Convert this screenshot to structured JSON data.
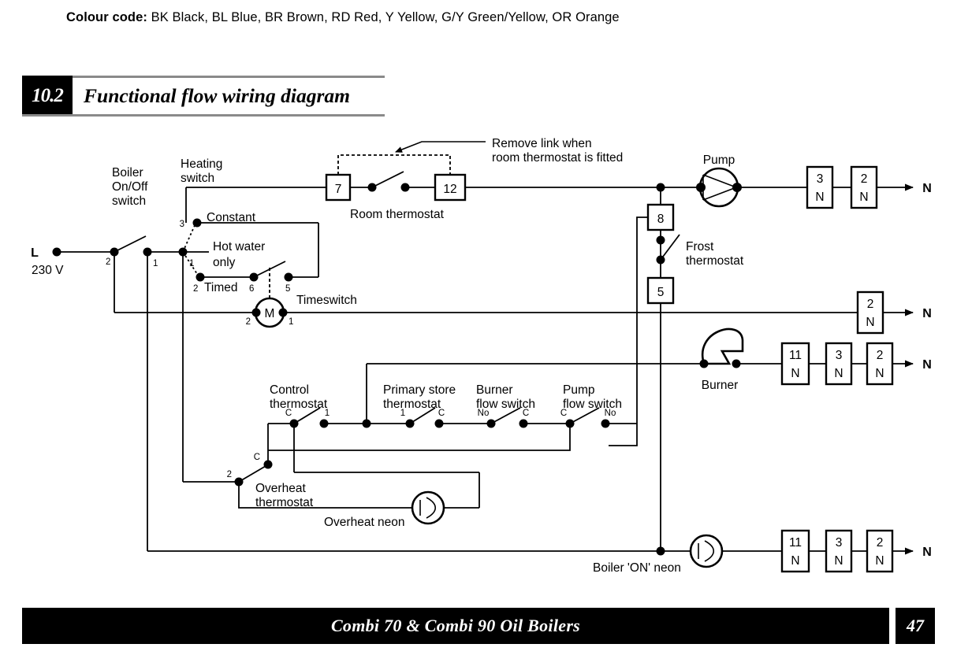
{
  "colour_code": {
    "label": "Colour code:",
    "text": " BK Black, BL Blue, BR Brown, RD Red, Y Yellow, G/Y Green/Yellow, OR Orange"
  },
  "section": {
    "number": "10.2",
    "title": "Functional flow wiring diagram"
  },
  "footer": {
    "title": "Combi 70 & Combi 90 Oil Boilers",
    "page": "47"
  },
  "diagram": {
    "supply": {
      "phase": "L",
      "voltage": "230 V"
    },
    "labels": {
      "boiler_onoff": [
        "Boiler",
        "On/Off",
        "switch"
      ],
      "heating_switch": [
        "Heating",
        "switch"
      ],
      "constant": "Constant",
      "hot_water_only": [
        "Hot water",
        "only"
      ],
      "timed": "Timed",
      "timeswitch": "Timeswitch",
      "room_thermostat": "Room thermostat",
      "remove_link": [
        "Remove link when",
        "room thermostat is fitted"
      ],
      "pump": "Pump",
      "frost_thermostat": [
        "Frost",
        "thermostat"
      ],
      "burner": "Burner",
      "control_thermostat": [
        "Control",
        "thermostat"
      ],
      "primary_store_thermostat": [
        "Primary store",
        "thermostat"
      ],
      "burner_flow_switch": [
        "Burner",
        "flow switch"
      ],
      "pump_flow_switch": [
        "Pump",
        "flow switch"
      ],
      "overheat_thermostat": [
        "Overheat",
        "thermostat"
      ],
      "overheat_neon": "Overheat neon",
      "boiler_on_neon": "Boiler 'ON' neon",
      "motor_symbol": "M"
    },
    "terminal_markers": {
      "boiler_onoff_left": "2",
      "boiler_onoff_right": "1",
      "selector_common": "1",
      "selector_constant": "3",
      "selector_timed": "2",
      "timeswitch_6": "6",
      "timeswitch_5": "5",
      "timeswitch_2": "2",
      "timeswitch_1": "1",
      "control_thermostat_c": "C",
      "control_thermostat_1": "1",
      "primary_store_1": "1",
      "primary_store_c": "C",
      "burner_flow_no": "No",
      "burner_flow_c": "C",
      "pump_flow_c": "C",
      "pump_flow_no": "No",
      "overheat_c": "C",
      "overheat_2": "2"
    },
    "terminal_blocks": [
      {
        "id": "t7",
        "top": "7",
        "bottom": ""
      },
      {
        "id": "t12",
        "top": "12",
        "bottom": ""
      },
      {
        "id": "t8",
        "top": "8",
        "bottom": ""
      },
      {
        "id": "t5",
        "top": "5",
        "bottom": ""
      }
    ],
    "neutral_rows": [
      {
        "id": "pump-row",
        "blocks": [
          {
            "top": "3",
            "bottom": "N"
          },
          {
            "top": "2",
            "bottom": "N"
          }
        ],
        "arrow_label": "N"
      },
      {
        "id": "timeswitch-row",
        "blocks": [
          {
            "top": "2",
            "bottom": "N"
          }
        ],
        "arrow_label": "N"
      },
      {
        "id": "burner-row",
        "blocks": [
          {
            "top": "11",
            "bottom": "N"
          },
          {
            "top": "3",
            "bottom": "N"
          },
          {
            "top": "2",
            "bottom": "N"
          }
        ],
        "arrow_label": "N"
      },
      {
        "id": "boiler-neon-row",
        "blocks": [
          {
            "top": "11",
            "bottom": "N"
          },
          {
            "top": "3",
            "bottom": "N"
          },
          {
            "top": "2",
            "bottom": "N"
          }
        ],
        "arrow_label": "N"
      }
    ],
    "colors": {
      "ink": "#000000",
      "rule": "#8a8a8a",
      "paper": "#ffffff"
    }
  }
}
